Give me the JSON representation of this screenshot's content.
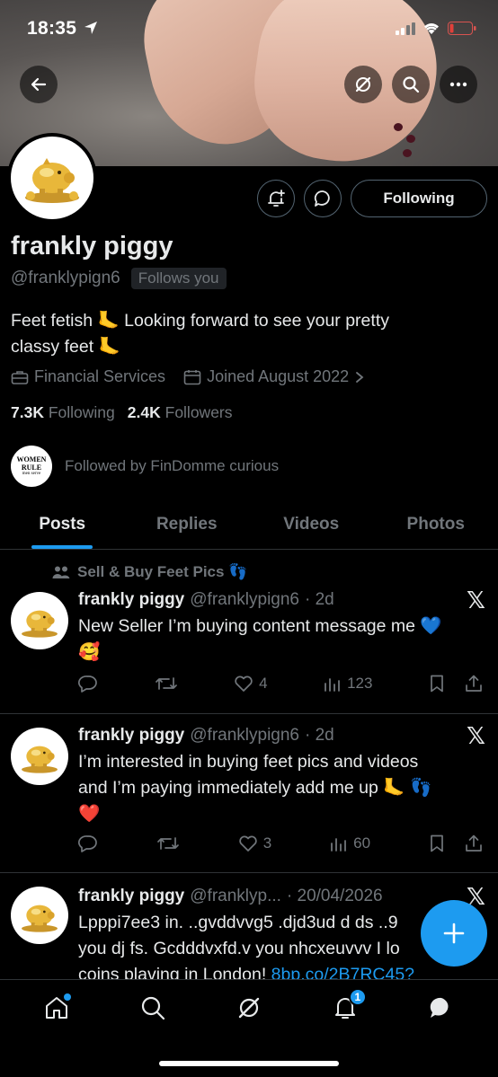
{
  "status_bar": {
    "time": "18:35"
  },
  "profile": {
    "name": "frankly piggy",
    "handle": "@franklypign6",
    "follows_you": "Follows you",
    "follow_state": "Following",
    "bio_line1": "Feet fetish 🦶 Looking forward to see your pretty",
    "bio_line2": "classy feet 🦶",
    "category": "Financial Services",
    "joined": "Joined August 2022",
    "following_count": "7.3K",
    "following_label": "Following",
    "followers_count": "2.4K",
    "followers_label": "Followers",
    "followed_by": "Followed by FinDomme curious",
    "followed_by_avatar_text": [
      "WOMEN",
      "RULE",
      "men serve"
    ]
  },
  "tabs": [
    {
      "label": "Posts",
      "active": true
    },
    {
      "label": "Replies",
      "active": false
    },
    {
      "label": "Videos",
      "active": false
    },
    {
      "label": "Photos",
      "active": false
    }
  ],
  "posts": [
    {
      "community": "Sell & Buy Feet Pics 👣",
      "name": "frankly piggy",
      "handle": "@franklypign6",
      "time": "· 2d",
      "text_line1": "New Seller I’m buying content message me 💙",
      "text_line2": "🥰",
      "replies": "",
      "reposts": "",
      "likes": "4",
      "views": "123"
    },
    {
      "name": "frankly piggy",
      "handle": "@franklypign6",
      "time": "· 2d",
      "text_line1": "I’m interested in buying feet pics and videos",
      "text_line2": "and I’m paying immediately add me up 🦶 👣",
      "text_line3": "❤️",
      "replies": "",
      "reposts": "",
      "likes": "3",
      "views": "60"
    },
    {
      "name": "frankly piggy",
      "handle": "@franklyp...",
      "time": "· 20/04/2026",
      "text_line1": "Lpppi7ee3 in. ..gvddvvg5 .djd3ud d ds ..9",
      "text_line2": "you dj fs. Gcdddvxfd.v you nhcxeuvvv I lo",
      "text_line3": "coins plaving in London! ",
      "link": "8bp.co/2B7RC45?"
    }
  ],
  "bottom_nav": {
    "notifications_badge": "1"
  },
  "colors": {
    "accent": "#1d9bf0",
    "muted": "#71767b",
    "text": "#e7e9ea",
    "border": "#2f3336"
  }
}
